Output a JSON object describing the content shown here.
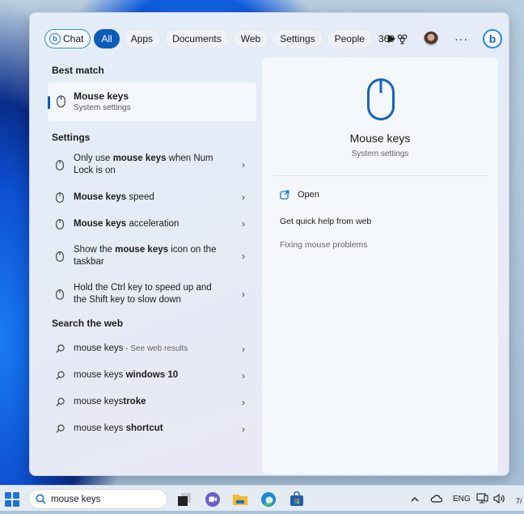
{
  "filters": {
    "chat": "Chat",
    "items": [
      "All",
      "Apps",
      "Documents",
      "Web",
      "Settings",
      "People"
    ],
    "active": "All"
  },
  "header": {
    "points": "369",
    "more": "···",
    "bing_logo": "b",
    "chat_logo": "b"
  },
  "best_match": {
    "heading": "Best match",
    "title": "Mouse keys",
    "subtitle": "System settings"
  },
  "settings": {
    "heading": "Settings",
    "items": [
      {
        "pre": "Only use ",
        "bold": "mouse keys",
        "post": " when Num Lock is on"
      },
      {
        "pre": "",
        "bold": "Mouse keys",
        "post": " speed"
      },
      {
        "pre": "",
        "bold": "Mouse keys",
        "post": " acceleration"
      },
      {
        "pre": "Show the ",
        "bold": "mouse keys",
        "post": " icon on the taskbar"
      },
      {
        "pre": "Hold the Ctrl key to speed up and the Shift key to slow down",
        "bold": "",
        "post": ""
      }
    ]
  },
  "web": {
    "heading": "Search the web",
    "items": [
      {
        "pre": "mouse keys",
        "bold": "",
        "suffix": " - See web results"
      },
      {
        "pre": "mouse keys ",
        "bold": "windows 10",
        "suffix": ""
      },
      {
        "pre": "mouse keys",
        "bold": "troke",
        "suffix": "",
        "pre_full": "mouse keys"
      },
      {
        "pre": "mouse keys ",
        "bold": "shortcut",
        "suffix": ""
      }
    ]
  },
  "preview": {
    "title": "Mouse keys",
    "subtitle": "System settings",
    "open": "Open",
    "help_heading": "Get quick help from web",
    "help_link": "Fixing mouse problems"
  },
  "taskbar": {
    "search_value": "mouse keys",
    "language": "ENG",
    "clock_partial": "7/"
  },
  "colors": {
    "accent": "#0a5cb8",
    "icon_blue": "#1565c0"
  }
}
